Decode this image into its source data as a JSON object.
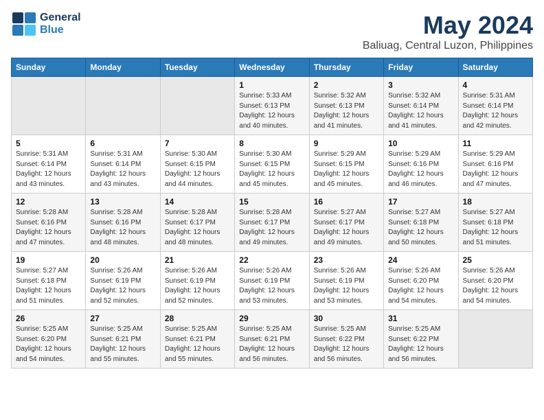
{
  "logo": {
    "general": "General",
    "blue": "Blue"
  },
  "title": "May 2024",
  "subtitle": "Baliuag, Central Luzon, Philippines",
  "headers": [
    "Sunday",
    "Monday",
    "Tuesday",
    "Wednesday",
    "Thursday",
    "Friday",
    "Saturday"
  ],
  "weeks": [
    [
      {
        "day": "",
        "info": ""
      },
      {
        "day": "",
        "info": ""
      },
      {
        "day": "",
        "info": ""
      },
      {
        "day": "1",
        "info": "Sunrise: 5:33 AM\nSunset: 6:13 PM\nDaylight: 12 hours\nand 40 minutes."
      },
      {
        "day": "2",
        "info": "Sunrise: 5:32 AM\nSunset: 6:13 PM\nDaylight: 12 hours\nand 41 minutes."
      },
      {
        "day": "3",
        "info": "Sunrise: 5:32 AM\nSunset: 6:14 PM\nDaylight: 12 hours\nand 41 minutes."
      },
      {
        "day": "4",
        "info": "Sunrise: 5:31 AM\nSunset: 6:14 PM\nDaylight: 12 hours\nand 42 minutes."
      }
    ],
    [
      {
        "day": "5",
        "info": "Sunrise: 5:31 AM\nSunset: 6:14 PM\nDaylight: 12 hours\nand 43 minutes."
      },
      {
        "day": "6",
        "info": "Sunrise: 5:31 AM\nSunset: 6:14 PM\nDaylight: 12 hours\nand 43 minutes."
      },
      {
        "day": "7",
        "info": "Sunrise: 5:30 AM\nSunset: 6:15 PM\nDaylight: 12 hours\nand 44 minutes."
      },
      {
        "day": "8",
        "info": "Sunrise: 5:30 AM\nSunset: 6:15 PM\nDaylight: 12 hours\nand 45 minutes."
      },
      {
        "day": "9",
        "info": "Sunrise: 5:29 AM\nSunset: 6:15 PM\nDaylight: 12 hours\nand 45 minutes."
      },
      {
        "day": "10",
        "info": "Sunrise: 5:29 AM\nSunset: 6:16 PM\nDaylight: 12 hours\nand 46 minutes."
      },
      {
        "day": "11",
        "info": "Sunrise: 5:29 AM\nSunset: 6:16 PM\nDaylight: 12 hours\nand 47 minutes."
      }
    ],
    [
      {
        "day": "12",
        "info": "Sunrise: 5:28 AM\nSunset: 6:16 PM\nDaylight: 12 hours\nand 47 minutes."
      },
      {
        "day": "13",
        "info": "Sunrise: 5:28 AM\nSunset: 6:16 PM\nDaylight: 12 hours\nand 48 minutes."
      },
      {
        "day": "14",
        "info": "Sunrise: 5:28 AM\nSunset: 6:17 PM\nDaylight: 12 hours\nand 48 minutes."
      },
      {
        "day": "15",
        "info": "Sunrise: 5:28 AM\nSunset: 6:17 PM\nDaylight: 12 hours\nand 49 minutes."
      },
      {
        "day": "16",
        "info": "Sunrise: 5:27 AM\nSunset: 6:17 PM\nDaylight: 12 hours\nand 49 minutes."
      },
      {
        "day": "17",
        "info": "Sunrise: 5:27 AM\nSunset: 6:18 PM\nDaylight: 12 hours\nand 50 minutes."
      },
      {
        "day": "18",
        "info": "Sunrise: 5:27 AM\nSunset: 6:18 PM\nDaylight: 12 hours\nand 51 minutes."
      }
    ],
    [
      {
        "day": "19",
        "info": "Sunrise: 5:27 AM\nSunset: 6:18 PM\nDaylight: 12 hours\nand 51 minutes."
      },
      {
        "day": "20",
        "info": "Sunrise: 5:26 AM\nSunset: 6:19 PM\nDaylight: 12 hours\nand 52 minutes."
      },
      {
        "day": "21",
        "info": "Sunrise: 5:26 AM\nSunset: 6:19 PM\nDaylight: 12 hours\nand 52 minutes."
      },
      {
        "day": "22",
        "info": "Sunrise: 5:26 AM\nSunset: 6:19 PM\nDaylight: 12 hours\nand 53 minutes."
      },
      {
        "day": "23",
        "info": "Sunrise: 5:26 AM\nSunset: 6:19 PM\nDaylight: 12 hours\nand 53 minutes."
      },
      {
        "day": "24",
        "info": "Sunrise: 5:26 AM\nSunset: 6:20 PM\nDaylight: 12 hours\nand 54 minutes."
      },
      {
        "day": "25",
        "info": "Sunrise: 5:26 AM\nSunset: 6:20 PM\nDaylight: 12 hours\nand 54 minutes."
      }
    ],
    [
      {
        "day": "26",
        "info": "Sunrise: 5:25 AM\nSunset: 6:20 PM\nDaylight: 12 hours\nand 54 minutes."
      },
      {
        "day": "27",
        "info": "Sunrise: 5:25 AM\nSunset: 6:21 PM\nDaylight: 12 hours\nand 55 minutes."
      },
      {
        "day": "28",
        "info": "Sunrise: 5:25 AM\nSunset: 6:21 PM\nDaylight: 12 hours\nand 55 minutes."
      },
      {
        "day": "29",
        "info": "Sunrise: 5:25 AM\nSunset: 6:21 PM\nDaylight: 12 hours\nand 56 minutes."
      },
      {
        "day": "30",
        "info": "Sunrise: 5:25 AM\nSunset: 6:22 PM\nDaylight: 12 hours\nand 56 minutes."
      },
      {
        "day": "31",
        "info": "Sunrise: 5:25 AM\nSunset: 6:22 PM\nDaylight: 12 hours\nand 56 minutes."
      },
      {
        "day": "",
        "info": ""
      }
    ]
  ]
}
